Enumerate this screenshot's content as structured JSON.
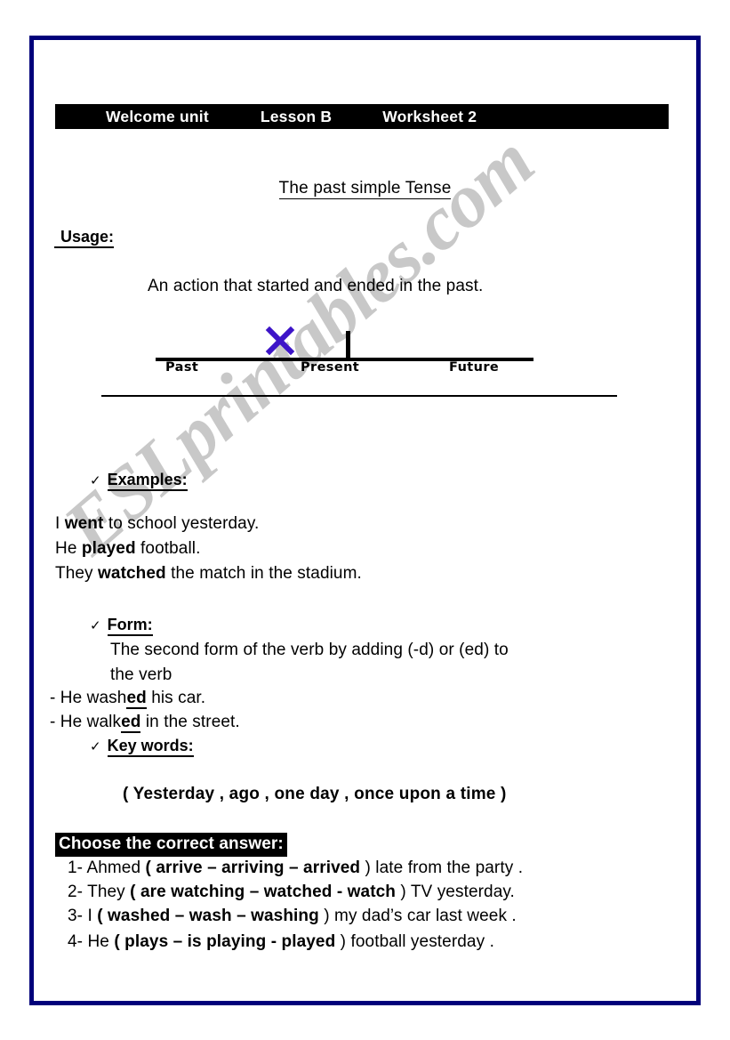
{
  "page": {
    "border_color": "#00007a",
    "background": "#ffffff"
  },
  "watermark": {
    "text": "ESLprintables.com",
    "color": "#c8c8c8"
  },
  "header": {
    "unit": "Welcome unit",
    "lesson": "Lesson B",
    "worksheet": "Worksheet 2",
    "background": "#000000",
    "text_color": "#ffffff"
  },
  "title": "The past simple Tense",
  "usage": {
    "heading": "Usage:",
    "sentence": "An action that started and ended in the past."
  },
  "timeline": {
    "labels": {
      "past": "Past",
      "present": "Present",
      "future": "Future"
    },
    "marker": "x-mark",
    "marker_color": "#3d14c8",
    "marker_position": "past"
  },
  "examples": {
    "heading": "Examples:",
    "bullet": "✓",
    "lines": [
      {
        "pre": "I ",
        "bold": "went",
        "post": " to school yesterday."
      },
      {
        "pre": "He ",
        "bold": "played",
        "post": " football."
      },
      {
        "pre": "They ",
        "bold": "watched",
        "post": " the match in the stadium."
      }
    ]
  },
  "form": {
    "heading": "Form:",
    "bullet": "✓",
    "description_line_1": "The second form of the verb by adding (-d) or (ed) to",
    "description_line_2": "the verb",
    "examples": [
      {
        "pre": "- He wash",
        "suffix": "ed",
        "post": " his car."
      },
      {
        "pre": "- He walk",
        "suffix": "ed",
        "post": " in the street."
      }
    ]
  },
  "key_words": {
    "heading": "Key words:",
    "bullet": "✓",
    "list": "( Yesterday , ago , one day , once upon a time  )"
  },
  "exercise": {
    "heading": "Choose the correct answer:",
    "questions": [
      {
        "number": "1- ",
        "pre": "Ahmed ",
        "choices": "( arrive – arriving – arrived",
        "post": " ) late from the party ."
      },
      {
        "number": "2- ",
        "pre": "They  ",
        "choices": "( are watching – watched - watch",
        "post": " ) TV yesterday."
      },
      {
        "number": "3- ",
        "pre": "I  ",
        "choices": "( washed – wash – washing",
        "post": " ) my dad’s car last week ."
      },
      {
        "number": "4- ",
        "pre": "He ",
        "choices": "( plays – is playing - played",
        "post": " )  football yesterday ."
      }
    ]
  }
}
